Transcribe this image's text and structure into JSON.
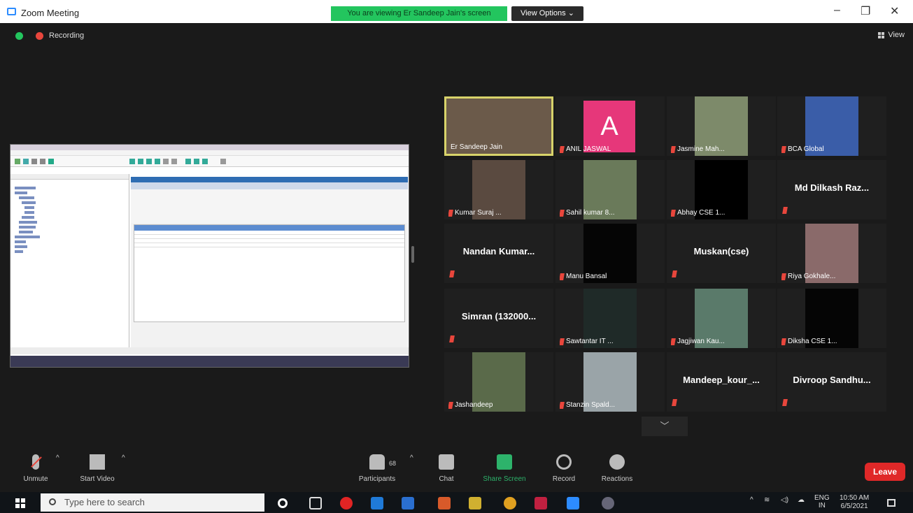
{
  "window": {
    "title": "Zoom Meeting",
    "share_banner": "You are viewing Er Sandeep Jain's screen",
    "view_options": "View Options ⌄"
  },
  "meeting": {
    "recording_label": "Recording",
    "view_label": "View"
  },
  "participants_grid": [
    {
      "name": "Er Sandeep Jain",
      "type": "video",
      "active": true,
      "photo_color": "#6b5a4a"
    },
    {
      "name": "ANIL JASWAL",
      "type": "avatar",
      "initial": "A"
    },
    {
      "name": "Jasmine Mah...",
      "type": "video",
      "photo_color": "#7d8a6a"
    },
    {
      "name": "BCA Global",
      "type": "video",
      "photo_color": "#3a5da8"
    },
    {
      "name": "Kumar Suraj ...",
      "type": "video",
      "photo_color": "#5a4a40"
    },
    {
      "name": "Sahil kumar 8...",
      "type": "video",
      "photo_color": "#6a7a5a"
    },
    {
      "name": "Abhay CSE 1...",
      "type": "video",
      "photo_color": "#000000"
    },
    {
      "name": "Md Dilkash Raz...",
      "type": "name"
    },
    {
      "name": "Nandan Kumar...",
      "type": "name"
    },
    {
      "name": "Manu Bansal",
      "type": "video",
      "photo_color": "#050505"
    },
    {
      "name": "Muskan(cse)",
      "type": "name"
    },
    {
      "name": "Riya Gokhale...",
      "type": "video",
      "photo_color": "#8a6a6a"
    },
    {
      "name": "Simran (132000...",
      "type": "name"
    },
    {
      "name": "Sawtantar IT ...",
      "type": "video",
      "photo_color": "#1f2a28"
    },
    {
      "name": "Jagjiwan Kau...",
      "type": "video",
      "photo_color": "#5a7a6a"
    },
    {
      "name": "Diksha CSE 1...",
      "type": "video",
      "photo_color": "#050505"
    },
    {
      "name": "Jashandeep",
      "type": "video",
      "photo_color": "#5a6a4a"
    },
    {
      "name": "Stanzin Spald...",
      "type": "video",
      "photo_color": "#9aa4a8"
    },
    {
      "name": "Mandeep_kour_...",
      "type": "name"
    },
    {
      "name": "Divroop Sandhu...",
      "type": "name"
    }
  ],
  "controls": {
    "unmute": "Unmute",
    "start_video": "Start Video",
    "participants": "Participants",
    "participants_count": "68",
    "chat": "Chat",
    "share_screen": "Share Screen",
    "record": "Record",
    "reactions": "Reactions",
    "leave": "Leave"
  },
  "taskbar": {
    "search_placeholder": "Type here to search",
    "lang_top": "ENG",
    "lang_bottom": "IN",
    "time": "10:50 AM",
    "date": "6/5/2021"
  },
  "colors": {
    "share_green": "#23c55e",
    "leave_red": "#e02828",
    "active_border": "#d8d36a",
    "avatar_pink": "#e6377a"
  }
}
